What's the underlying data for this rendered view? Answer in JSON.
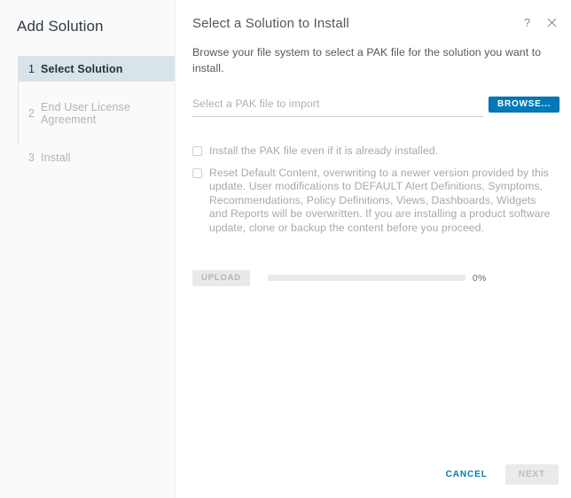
{
  "sidebar": {
    "title": "Add Solution",
    "steps": [
      {
        "num": "1",
        "label": "Select Solution",
        "state": "active"
      },
      {
        "num": "2",
        "label": "End User License Agreement",
        "state": "inactive"
      },
      {
        "num": "3",
        "label": "Install",
        "state": "inactive"
      }
    ]
  },
  "panel": {
    "title": "Select a Solution to Install",
    "description": "Browse your file system to select a PAK file for the solution you want to install.",
    "help_icon": "question-mark-icon",
    "close_icon": "close-icon"
  },
  "file_picker": {
    "placeholder": "Select a PAK file to import",
    "value": "",
    "browse_label": "BROWSE..."
  },
  "options": [
    {
      "id": "force-install",
      "label": "Install the PAK file even if it is already installed.",
      "checked": false
    },
    {
      "id": "reset-default-content",
      "label": "Reset Default Content, overwriting to a newer version provided by this update. User modifications to DEFAULT Alert Definitions, Symptoms, Recommendations, Policy Definitions, Views, Dashboards, Widgets and Reports will be overwritten. If you are installing a product software update, clone or backup the content before you proceed.",
      "checked": false
    }
  ],
  "upload": {
    "button_label": "UPLOAD",
    "progress_percent": 0,
    "progress_label": "0%"
  },
  "footer": {
    "cancel_label": "CANCEL",
    "next_label": "NEXT"
  },
  "colors": {
    "accent_blue": "#0079b8",
    "active_step_bg": "#d9e4ea",
    "sidebar_bg": "#fafafa",
    "disabled_grey": "#e9e9e9",
    "muted_text": "#a9a9a9"
  }
}
